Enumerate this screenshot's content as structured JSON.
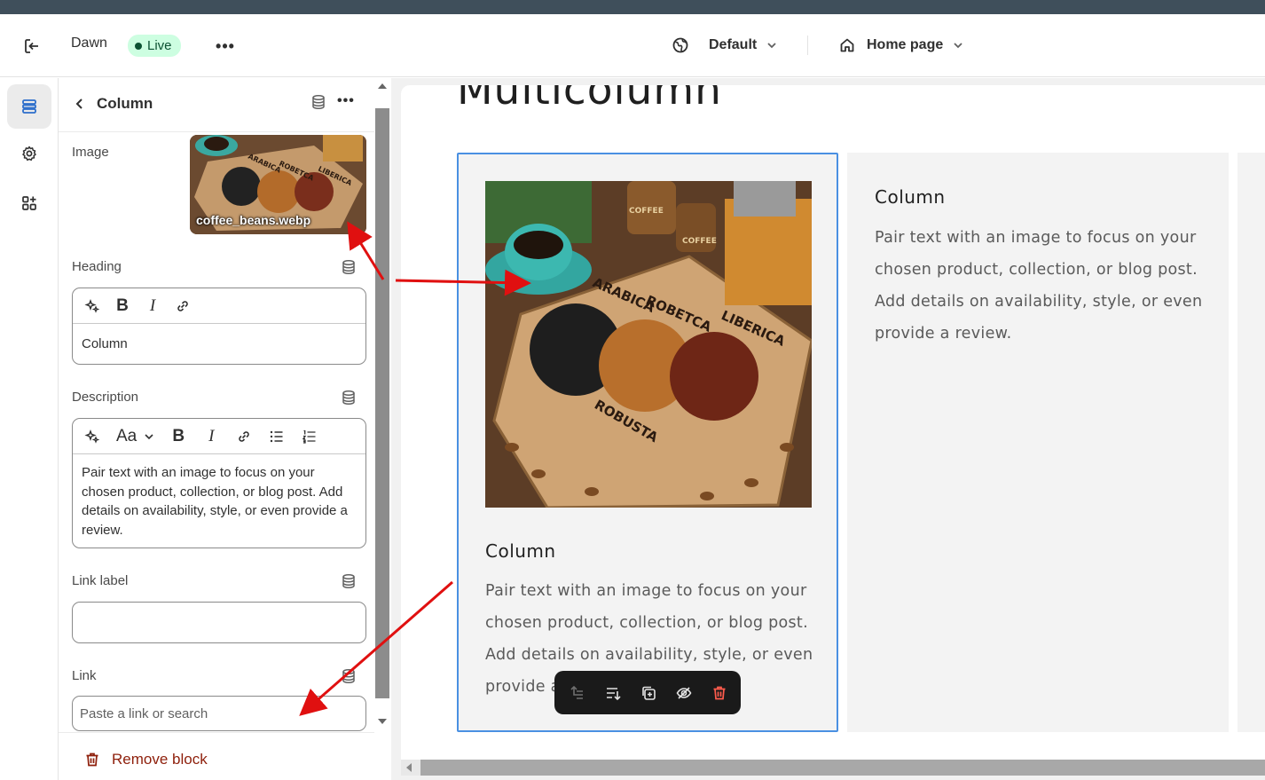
{
  "topbar": {
    "theme_name": "Dawn",
    "status_badge": "Live",
    "context_label": "Default",
    "page_selector": "Home page"
  },
  "panel": {
    "title": "Column",
    "image": {
      "label": "Image",
      "filename": "coffee_beans.webp"
    },
    "heading": {
      "label": "Heading",
      "value": "Column"
    },
    "description": {
      "label": "Description",
      "format_label": "Aa",
      "value": "Pair text with an image to focus on your chosen product, collection, or blog post. Add details on availability, style, or even provide a review."
    },
    "link_label": {
      "label": "Link label",
      "value": ""
    },
    "link": {
      "label": "Link",
      "placeholder": "Paste a link or search"
    },
    "remove_label": "Remove block"
  },
  "preview": {
    "section_title": "Multicolumn",
    "columns": [
      {
        "heading": "Column",
        "text": "Pair text with an image to focus on your chosen product, collection, or blog post. Add details on availability, style, or even provide a review."
      },
      {
        "heading": "Column",
        "text": "Pair text with an image to focus on your chosen product, collection, or blog post. Add details on availability, style, or even provide a review."
      }
    ],
    "col1_visible_text": "Pair text with an image to focus on your chosen product, collection, or blog post. Add details on availability, style, or even provide a",
    "image_labels": [
      "ARABICA",
      "ROBETCA",
      "LIBERICA",
      "ROBUSTA",
      "COFFEE",
      "COFFEE"
    ]
  },
  "colors": {
    "accent_selection": "#4a90e2",
    "annotation_arrow": "#e01010",
    "live_badge_bg": "#cdfee1",
    "remove_text": "#8e1f0b"
  }
}
